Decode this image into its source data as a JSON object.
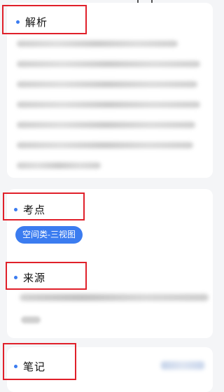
{
  "sections": {
    "analysis": {
      "title": "解析"
    },
    "keypoint": {
      "title": "考点",
      "tag": "空间类-三视图"
    },
    "source": {
      "title": "来源"
    },
    "notes": {
      "title": "笔记"
    }
  },
  "colors": {
    "accent": "#3b7cf0",
    "highlight_box": "#e0202a"
  }
}
